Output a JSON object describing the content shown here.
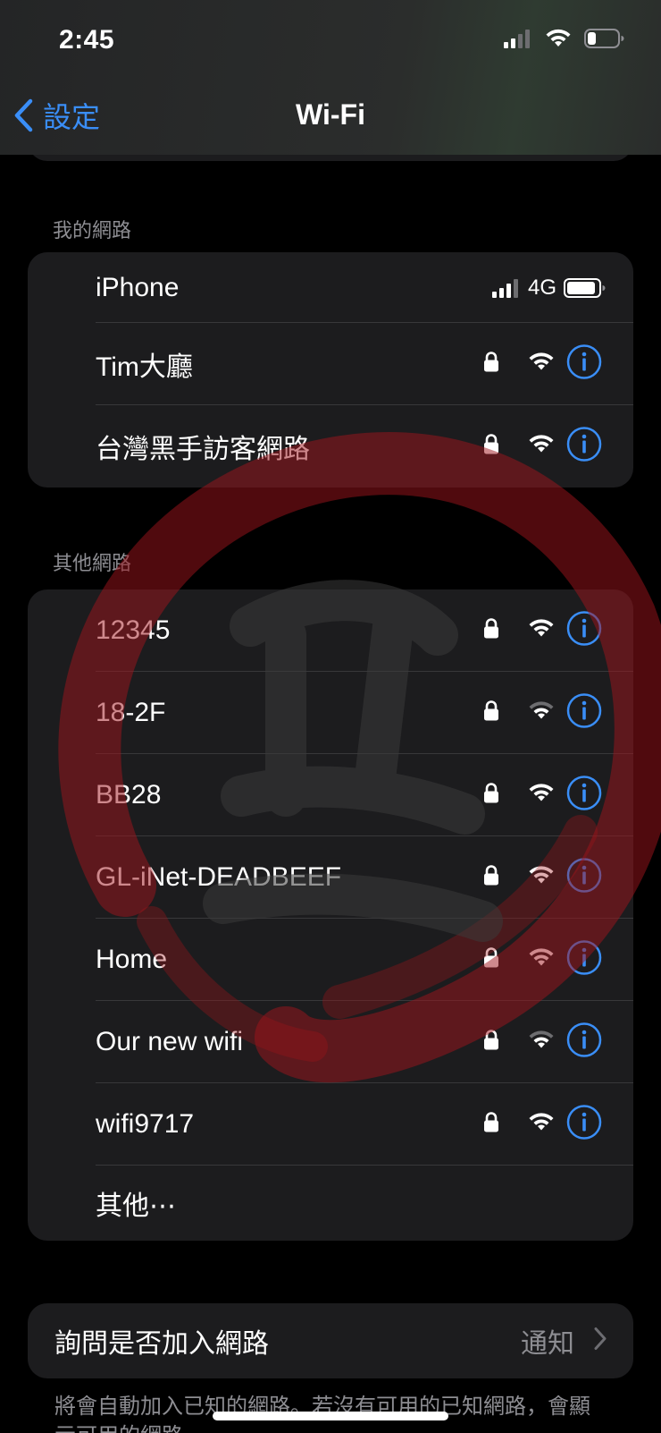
{
  "status_bar": {
    "time": "2:45"
  },
  "nav": {
    "back_label": "設定",
    "title": "Wi-Fi"
  },
  "my_networks": {
    "header": "我的網路",
    "hotspot": {
      "name": "iPhone",
      "cell_type": "4G"
    },
    "items": [
      {
        "name": "Tim大廳"
      },
      {
        "name": "台灣黑手訪客網路"
      }
    ]
  },
  "other_networks": {
    "header": "其他網路",
    "items": [
      {
        "name": "12345"
      },
      {
        "name": "18-2F"
      },
      {
        "name": "BB28"
      },
      {
        "name": "GL-iNet-DEADBEEF"
      },
      {
        "name": "Home"
      },
      {
        "name": "Our new wifi"
      },
      {
        "name": "wifi9717"
      }
    ],
    "other_label": "其他⋯"
  },
  "ask_to_join": {
    "label": "詢問是否加入網路",
    "value": "通知"
  },
  "footer_note": "將會自動加入已知的網路。若沒有可用的已知網路，會顯示可用的網路。",
  "colors": {
    "accent": "#3a8ef7",
    "card": "#1c1c1e",
    "secondary_text": "#8d8d92",
    "watermark": "#a0141b"
  }
}
